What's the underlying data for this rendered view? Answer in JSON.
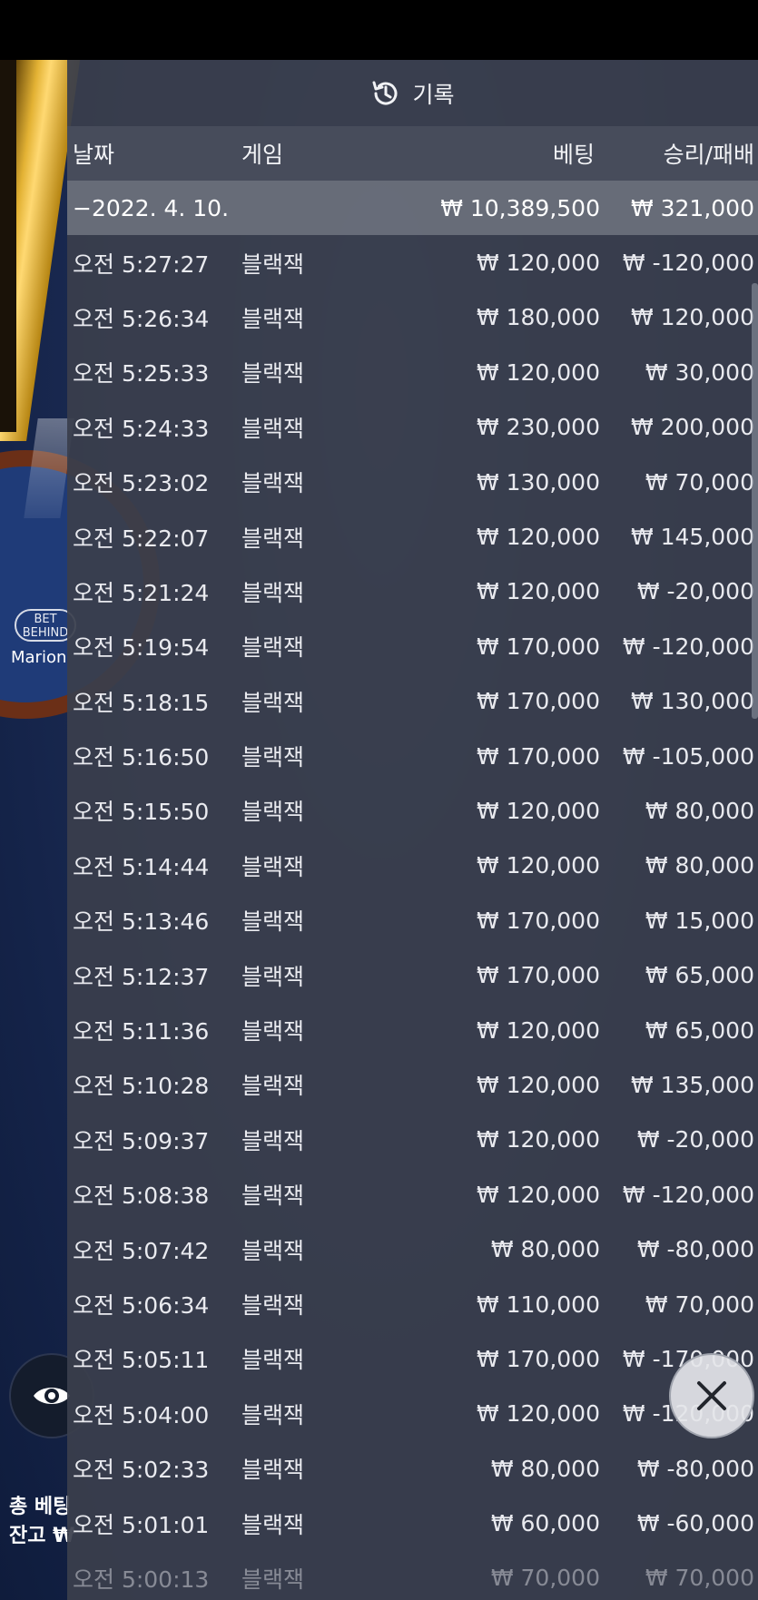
{
  "header": {
    "title": "기록",
    "icon": "history-icon"
  },
  "columns": {
    "date": "날짜",
    "game": "게임",
    "bet": "베팅",
    "result": "승리/패배"
  },
  "summary": {
    "date": "−2022. 4. 10.",
    "bet": "₩ 10,389,500",
    "result": "₩ 321,000"
  },
  "rows": [
    {
      "time": "오전 5:27:27",
      "game": "블랙잭",
      "bet": "₩ 120,000",
      "result": "₩ -120,000"
    },
    {
      "time": "오전 5:26:34",
      "game": "블랙잭",
      "bet": "₩ 180,000",
      "result": "₩ 120,000"
    },
    {
      "time": "오전 5:25:33",
      "game": "블랙잭",
      "bet": "₩ 120,000",
      "result": "₩ 30,000"
    },
    {
      "time": "오전 5:24:33",
      "game": "블랙잭",
      "bet": "₩ 230,000",
      "result": "₩ 200,000"
    },
    {
      "time": "오전 5:23:02",
      "game": "블랙잭",
      "bet": "₩ 130,000",
      "result": "₩ 70,000"
    },
    {
      "time": "오전 5:22:07",
      "game": "블랙잭",
      "bet": "₩ 120,000",
      "result": "₩ 145,000"
    },
    {
      "time": "오전 5:21:24",
      "game": "블랙잭",
      "bet": "₩ 120,000",
      "result": "₩ -20,000"
    },
    {
      "time": "오전 5:19:54",
      "game": "블랙잭",
      "bet": "₩ 170,000",
      "result": "₩ -120,000"
    },
    {
      "time": "오전 5:18:15",
      "game": "블랙잭",
      "bet": "₩ 170,000",
      "result": "₩ 130,000"
    },
    {
      "time": "오전 5:16:50",
      "game": "블랙잭",
      "bet": "₩ 170,000",
      "result": "₩ -105,000"
    },
    {
      "time": "오전 5:15:50",
      "game": "블랙잭",
      "bet": "₩ 120,000",
      "result": "₩ 80,000"
    },
    {
      "time": "오전 5:14:44",
      "game": "블랙잭",
      "bet": "₩ 120,000",
      "result": "₩ 80,000"
    },
    {
      "time": "오전 5:13:46",
      "game": "블랙잭",
      "bet": "₩ 170,000",
      "result": "₩ 15,000"
    },
    {
      "time": "오전 5:12:37",
      "game": "블랙잭",
      "bet": "₩ 170,000",
      "result": "₩ 65,000"
    },
    {
      "time": "오전 5:11:36",
      "game": "블랙잭",
      "bet": "₩ 120,000",
      "result": "₩ 65,000"
    },
    {
      "time": "오전 5:10:28",
      "game": "블랙잭",
      "bet": "₩ 120,000",
      "result": "₩ 135,000"
    },
    {
      "time": "오전 5:09:37",
      "game": "블랙잭",
      "bet": "₩ 120,000",
      "result": "₩ -20,000"
    },
    {
      "time": "오전 5:08:38",
      "game": "블랙잭",
      "bet": "₩ 120,000",
      "result": "₩ -120,000"
    },
    {
      "time": "오전 5:07:42",
      "game": "블랙잭",
      "bet": "₩ 80,000",
      "result": "₩ -80,000"
    },
    {
      "time": "오전 5:06:34",
      "game": "블랙잭",
      "bet": "₩ 110,000",
      "result": "₩ 70,000"
    },
    {
      "time": "오전 5:05:11",
      "game": "블랙잭",
      "bet": "₩ 170,000",
      "result": "₩ -170,000"
    },
    {
      "time": "오전 5:04:00",
      "game": "블랙잭",
      "bet": "₩ 120,000",
      "result": "₩ -120,000"
    },
    {
      "time": "오전 5:02:33",
      "game": "블랙잭",
      "bet": "₩ 80,000",
      "result": "₩ -80,000"
    },
    {
      "time": "오전 5:01:01",
      "game": "블랙잭",
      "bet": "₩ 60,000",
      "result": "₩ -60,000"
    },
    {
      "time": "오전 5:00:13",
      "game": "블랙잭",
      "bet": "₩ 70,000",
      "result": "₩ 70,000"
    }
  ],
  "background": {
    "bet_behind": "BET BEHIND",
    "player_name": "Marion",
    "total_bet_label": "총 베팅",
    "balance_label": "잔고 ₩"
  },
  "controls": {
    "close_icon": "close-icon",
    "eye_icon": "eye-icon"
  }
}
